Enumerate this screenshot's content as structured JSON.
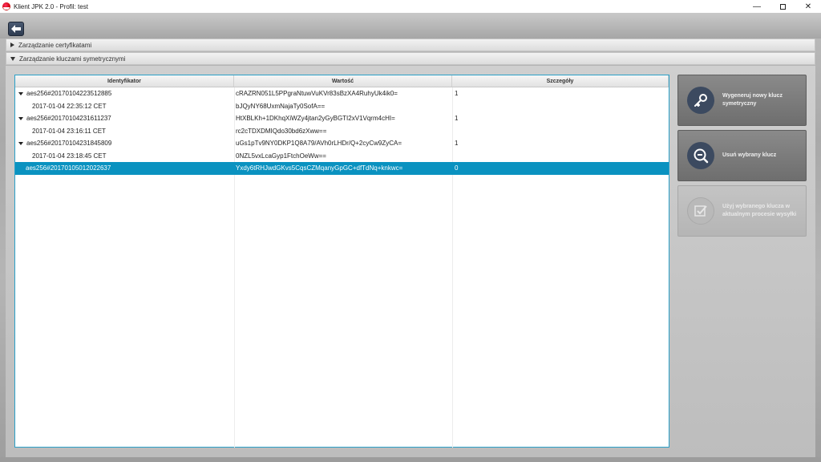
{
  "window": {
    "title": "Klient JPK 2.0 - Profil: test",
    "minimize_label": "—",
    "close_label": "✕"
  },
  "accordion": {
    "certificates_label": "Zarządzanie certyfikatami",
    "symmetric_keys_label": "Zarządzanie kluczami symetrycznymi"
  },
  "table": {
    "headers": [
      "Identyfikator",
      "Wartość",
      "Szczegóły"
    ],
    "rows": [
      {
        "id": "aes256#20170104223512885",
        "value": "cRAZRN051L5PPgraNtuwVuKVr83sBzXA4RuhyUk4ik0=",
        "details": "1"
      },
      {
        "id": "2017-01-04 22:35:12 CET",
        "value": "bJQyNY68UxmNajaTy0SofA==",
        "details": ""
      },
      {
        "id": "aes256#20170104231611237",
        "value": "HtXBLKh+1DKhqXiWZy4jtan2yGyBGTI2xV1Vqrm4cHI=",
        "details": "1"
      },
      {
        "id": "2017-01-04 23:16:11 CET",
        "value": "rc2cTDXDMIQdo30bd6zXww==",
        "details": ""
      },
      {
        "id": "aes256#20170104231845809",
        "value": "uGs1pTv9NY0DKP1Q8A79/AVh0rLHDr/Q+2cyCw9ZyCA=",
        "details": "1"
      },
      {
        "id": "2017-01-04 23:18:45 CET",
        "value": "0NZL5vxLcaGyp1FtchOeWw==",
        "details": ""
      },
      {
        "id": "aes256#20170105012022637",
        "value": "Yxdy6tRHJwdGKvs5CqsCZMqanyGpGC+dfTdNq+knkwc=",
        "details": "0"
      }
    ]
  },
  "actions": {
    "generate_label": "Wygeneruj nowy klucz symetryczny",
    "delete_label": "Usuń wybrany klucz",
    "use_label": "Użyj wybranego klucza w aktualnym procesie wysyłki"
  },
  "colors": {
    "selection": "#0a92c0",
    "button_dark": "#6e6e6e",
    "icon_circle": "#3c4a60"
  }
}
